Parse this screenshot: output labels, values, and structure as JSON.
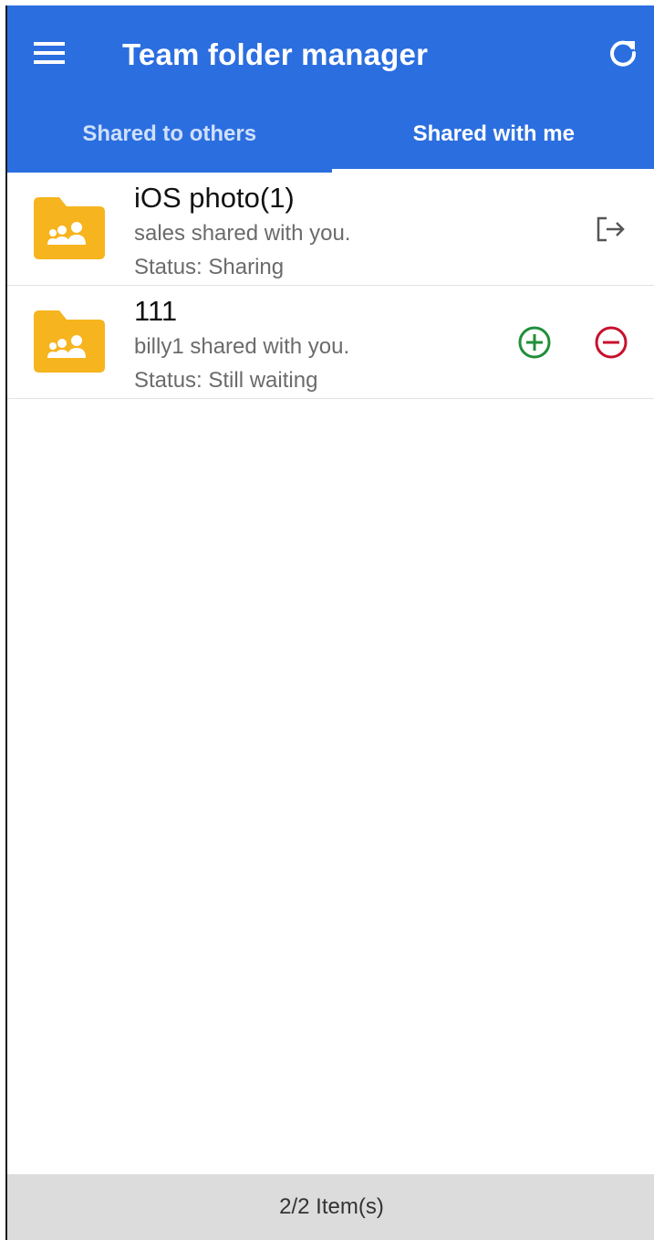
{
  "app_bar": {
    "title": "Team folder manager",
    "menu_icon": "hamburger-menu-icon",
    "refresh_icon": "refresh-icon",
    "background_color": "#2b6ee0"
  },
  "tabs": [
    {
      "label": "Shared to others",
      "active": false
    },
    {
      "label": "Shared with me",
      "active": true
    }
  ],
  "items": [
    {
      "title": "iOS photo(1)",
      "shared_by": "sales shared with you.",
      "status": "Status: Sharing",
      "icon": "team-folder-icon",
      "actions": [
        "leave-icon"
      ]
    },
    {
      "title": "111",
      "shared_by": "billy1 shared with you.",
      "status": "Status: Still waiting",
      "icon": "team-folder-icon",
      "actions": [
        "accept-icon",
        "decline-icon"
      ]
    }
  ],
  "footer": {
    "count": "2/2 Item(s)"
  },
  "colors": {
    "folder": "#f6b41e",
    "accept": "#1f8f3a",
    "decline": "#c8102e",
    "footer_bg": "#dcdcdc"
  }
}
